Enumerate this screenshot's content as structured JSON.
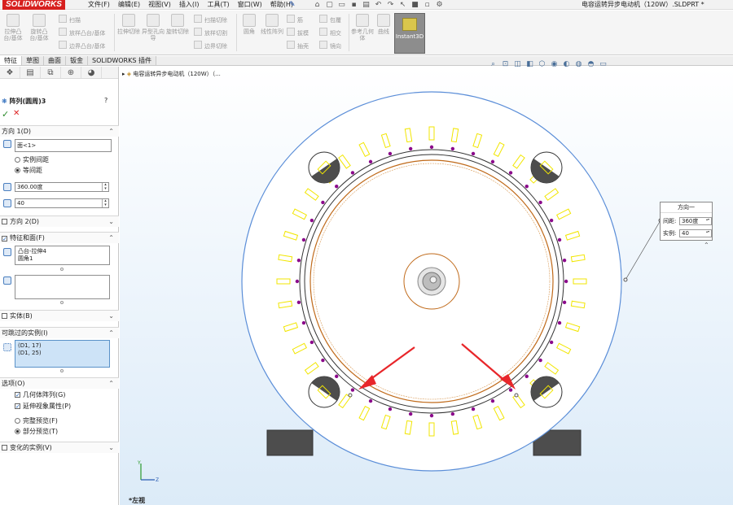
{
  "app": {
    "logo": "SOLIDWORKS",
    "doc_title": "电容运转异步电动机（120W）.SLDPRT *"
  },
  "menu": [
    "文件(F)",
    "编辑(E)",
    "视图(V)",
    "插入(I)",
    "工具(T)",
    "窗口(W)",
    "帮助(H)"
  ],
  "ribbon": {
    "big_buttons": [
      "拉伸凸台/基体",
      "旋转凸台/基体",
      "拉伸切除",
      "异型孔向导",
      "旋转切除",
      "圆角",
      "线性阵列",
      "参考几何体",
      "曲线"
    ],
    "small_buttons": [
      "扫描",
      "放样凸台/基体",
      "边界凸台/基体",
      "扫描切除",
      "放样切割",
      "边界切除",
      "筋",
      "拔模",
      "抽壳",
      "包覆",
      "相交",
      "镜向"
    ],
    "instant3d": "Instant3D"
  },
  "tabs": [
    "特征",
    "草图",
    "曲面",
    "钣金",
    "SOLIDWORKS 插件"
  ],
  "tree": {
    "root": "电容运转异步电动机（120W）（..."
  },
  "pm": {
    "title": "阵列(圆周)3",
    "help": "?",
    "ok": "✓",
    "cancel": "✕",
    "direction1": {
      "header": "方向 1(D)",
      "face": "面<1>",
      "radio_spacing": "实例间距",
      "radio_equal": "等间距",
      "angle": "360.00度",
      "count": "40"
    },
    "direction2": {
      "header": "方向 2(D)"
    },
    "features": {
      "header": "特征和面(F)",
      "items": [
        "凸台-拉伸4",
        "圆角1"
      ]
    },
    "bodies": {
      "header": "实体(B)"
    },
    "skip": {
      "header": "可跳过的实例(I)",
      "items": [
        "(D1, 17)",
        "(D1, 25)"
      ]
    },
    "options": {
      "header": "选项(O)",
      "geometry_pattern": "几何体阵列(G)",
      "propagate": "延伸视象属性(P)",
      "full_preview": "完整预览(F)",
      "partial_preview": "部分预览(T)"
    },
    "vary": {
      "header": "变化的实例(V)"
    }
  },
  "callout": {
    "title": "方向一",
    "spacing_label": "间距:",
    "spacing_value": "360度",
    "count_label": "实例:",
    "count_value": "40"
  },
  "status": "*左视",
  "colors": {
    "arrow": "#e8262a",
    "accent": "#1b5fb6",
    "slot": "#f2e600",
    "dot": "#8b0a8b",
    "rotor": "#c06a1a"
  }
}
